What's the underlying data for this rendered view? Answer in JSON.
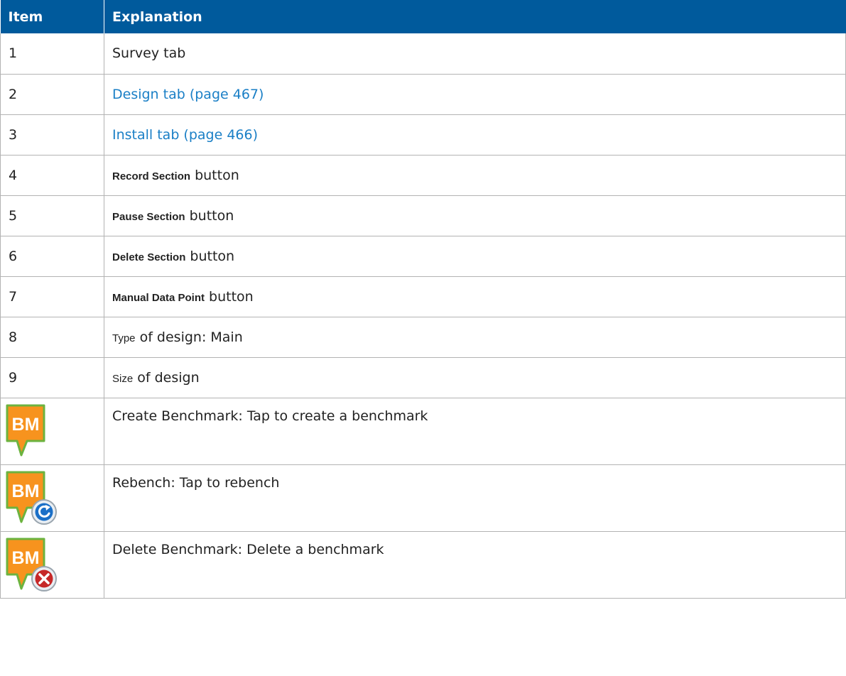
{
  "header": {
    "col_item": "Item",
    "col_explanation": "Explanation"
  },
  "rows": [
    {
      "item": "1",
      "text": "Survey tab"
    },
    {
      "item": "2",
      "link": "Design tab (page 467)"
    },
    {
      "item": "3",
      "link": "Install tab (page 466)"
    },
    {
      "item": "4",
      "label": "Record Section",
      "suffix": " button"
    },
    {
      "item": "5",
      "label": "Pause Section",
      "suffix": " button"
    },
    {
      "item": "6",
      "label": "Delete Section",
      "suffix": " button"
    },
    {
      "item": "7",
      "label": "Manual Data Point",
      "suffix": " button"
    },
    {
      "item": "8",
      "label": "Type",
      "suffix": " of design: Main"
    },
    {
      "item": "9",
      "label": "Size",
      "suffix": " of design"
    }
  ],
  "icon_rows": [
    {
      "icon": "create-benchmark-icon",
      "icon_text": "BM",
      "text": "Create Benchmark: Tap to create a benchmark"
    },
    {
      "icon": "rebench-icon",
      "icon_text": "BM",
      "text": "Rebench: Tap to rebench"
    },
    {
      "icon": "delete-benchmark-icon",
      "icon_text": "BM",
      "text": "Delete Benchmark: Delete a benchmark"
    }
  ],
  "colors": {
    "header_bg": "#005a9c",
    "link": "#1a7fc6",
    "icon_orange": "#f7931e",
    "icon_green": "#6cb33f"
  }
}
